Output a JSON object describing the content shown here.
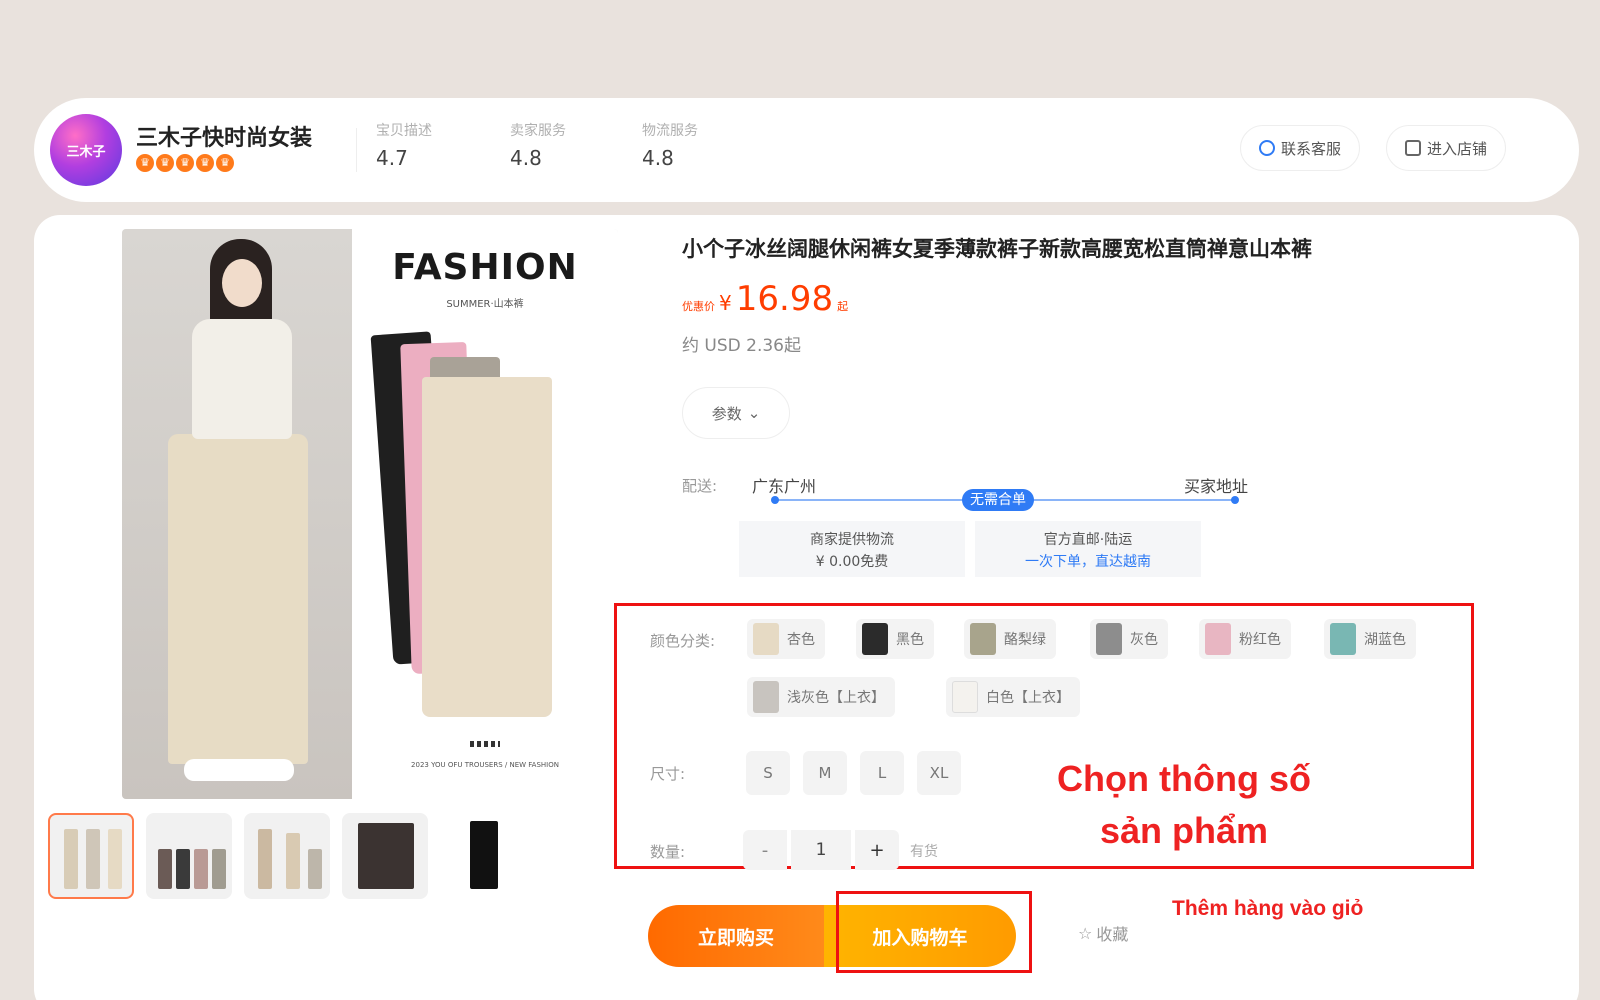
{
  "shop": {
    "name": "三木子快时尚女装",
    "logo_text": "三木子",
    "ratings": [
      {
        "label": "宝贝描述",
        "value": "4.7"
      },
      {
        "label": "卖家服务",
        "value": "4.8"
      },
      {
        "label": "物流服务",
        "value": "4.8"
      }
    ],
    "contact_label": "联系客服",
    "enter_store_label": "进入店铺"
  },
  "gallery": {
    "banner_title": "FASHION",
    "banner_sub": "SUMMER·山本裤",
    "banner_foot": "2023 YOU OFU TROUSERS / NEW FASHION",
    "thumbnail_count": 5
  },
  "product": {
    "title": "小个子冰丝阔腿休闲裤女夏季薄款裤子新款高腰宽松直筒禅意山本裤",
    "price_prefix": "优惠价",
    "price_currency": "¥",
    "price": "16.98",
    "price_suffix": "起",
    "usd": "约 USD 2.36起",
    "params_label": "参数"
  },
  "shipping": {
    "label": "配送:",
    "from": "广东广州",
    "to": "买家地址",
    "tag": "无需合单",
    "option1_title": "商家提供物流",
    "option1_value": "¥ 0.00免费",
    "option2_title": "官方直邮·陆运",
    "option2_value": "一次下单，直达越南"
  },
  "options": {
    "color_label": "颜色分类:",
    "colors": [
      {
        "name": "杏色",
        "swatch": "#e6dac4"
      },
      {
        "name": "黑色",
        "swatch": "#2b2b2b"
      },
      {
        "name": "酪梨绿",
        "swatch": "#a8a48c"
      },
      {
        "name": "灰色",
        "swatch": "#8d8d8d"
      },
      {
        "name": "粉红色",
        "swatch": "#e8b6c2"
      },
      {
        "name": "湖蓝色",
        "swatch": "#79b7b3"
      },
      {
        "name": "浅灰色【上衣】",
        "swatch": "#c8c4bf"
      },
      {
        "name": "白色【上衣】",
        "swatch": "#f4f2ee"
      }
    ],
    "size_label": "尺寸:",
    "sizes": [
      "S",
      "M",
      "L",
      "XL"
    ],
    "qty_label": "数量:",
    "qty_minus": "-",
    "qty_value": "1",
    "qty_plus": "+",
    "stock_text": "有货"
  },
  "actions": {
    "buy_now": "立即购买",
    "add_to_cart": "加入购物车",
    "favorite": "收藏",
    "favorite_icon": "☆"
  },
  "annotations": {
    "select_spec_line1": "Chọn thông số",
    "select_spec_line2": "sản phẩm",
    "add_to_cart_note": "Thêm hàng vào giỏ"
  },
  "colors": {
    "accent_price": "#ff3d00",
    "annotation_red": "#ee2222",
    "ship_blue": "#2f7bf5"
  }
}
